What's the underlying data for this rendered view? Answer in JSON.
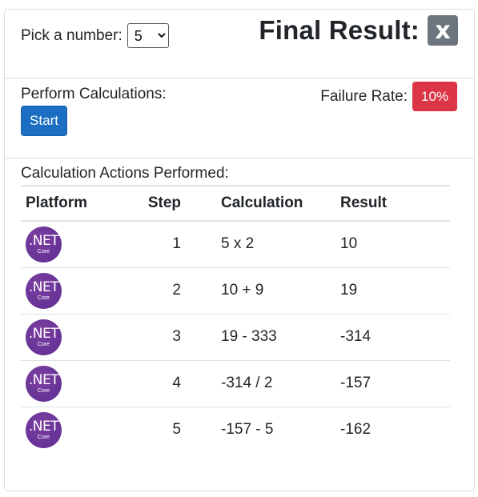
{
  "picker": {
    "label": "Pick a number:",
    "selected": "5"
  },
  "final": {
    "title": "Final Result:",
    "value": "x"
  },
  "perform": {
    "label": "Perform Calculations:",
    "button": "Start"
  },
  "failure": {
    "label": "Failure Rate:",
    "value": "10%"
  },
  "actions": {
    "label": "Calculation Actions Performed:",
    "headers": {
      "platform": "Platform",
      "step": "Step",
      "calculation": "Calculation",
      "result": "Result"
    },
    "logo": {
      "main": ".NET",
      "sub": "Core"
    },
    "rows": [
      {
        "step": "1",
        "calculation": "5 x 2",
        "result": "10"
      },
      {
        "step": "2",
        "calculation": "10 + 9",
        "result": "19"
      },
      {
        "step": "3",
        "calculation": "19 - 333",
        "result": "-314"
      },
      {
        "step": "4",
        "calculation": "-314 / 2",
        "result": "-157"
      },
      {
        "step": "5",
        "calculation": "-157 - 5",
        "result": "-162"
      }
    ]
  },
  "colors": {
    "primary": "#1b6ec2",
    "danger": "#dc3545",
    "secondary": "#6c757d",
    "dotnet": "#5c2d91"
  }
}
